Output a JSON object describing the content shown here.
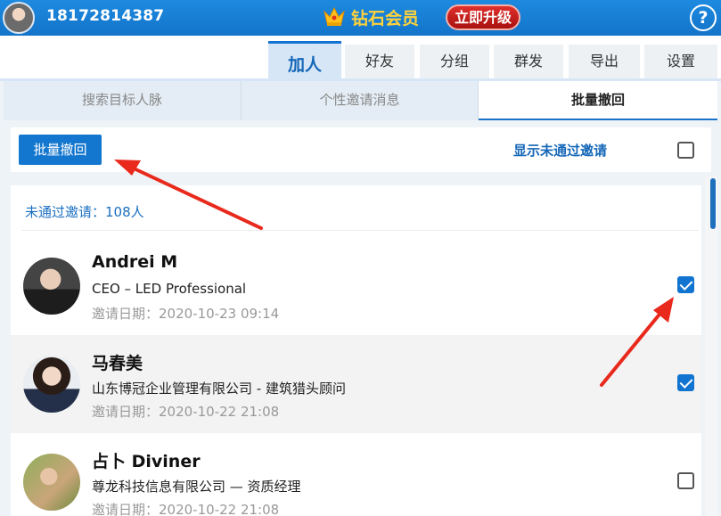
{
  "header": {
    "phone": "18172814387",
    "vip_label": "钻石会员",
    "upgrade_label": "立即升级",
    "help_label": "?"
  },
  "tabs": [
    {
      "label": "加人",
      "active": true
    },
    {
      "label": "好友",
      "active": false
    },
    {
      "label": "分组",
      "active": false
    },
    {
      "label": "群发",
      "active": false
    },
    {
      "label": "导出",
      "active": false
    },
    {
      "label": "设置",
      "active": false
    }
  ],
  "subtabs": [
    {
      "label": "搜索目标人脉",
      "active": false
    },
    {
      "label": "个性邀请消息",
      "active": false
    },
    {
      "label": "批量撤回",
      "active": true
    }
  ],
  "toolbar": {
    "batch_revoke_label": "批量撤回",
    "show_pending_label": "显示未通过邀请",
    "show_pending_checked": false
  },
  "list": {
    "count_label": "未通过邀请：108人",
    "items": [
      {
        "name": "Andrei M",
        "title": "CEO – LED Professional",
        "date": "邀请日期：2020-10-23 09:14",
        "checked": true
      },
      {
        "name": "马春美",
        "title": "山东博冠企业管理有限公司 - 建筑猎头顾问",
        "date": "邀请日期：2020-10-22 21:08",
        "checked": true
      },
      {
        "name": "占卜 Diviner",
        "title": "尊龙科技信息有限公司 — 资质经理",
        "date": "邀请日期：2020-10-22 21:08",
        "checked": false
      }
    ]
  },
  "colors": {
    "accent": "#1477cf",
    "annotation_arrow": "#e8291c",
    "vip_gold": "#ffd23a",
    "upgrade_red": "#c8201d"
  }
}
